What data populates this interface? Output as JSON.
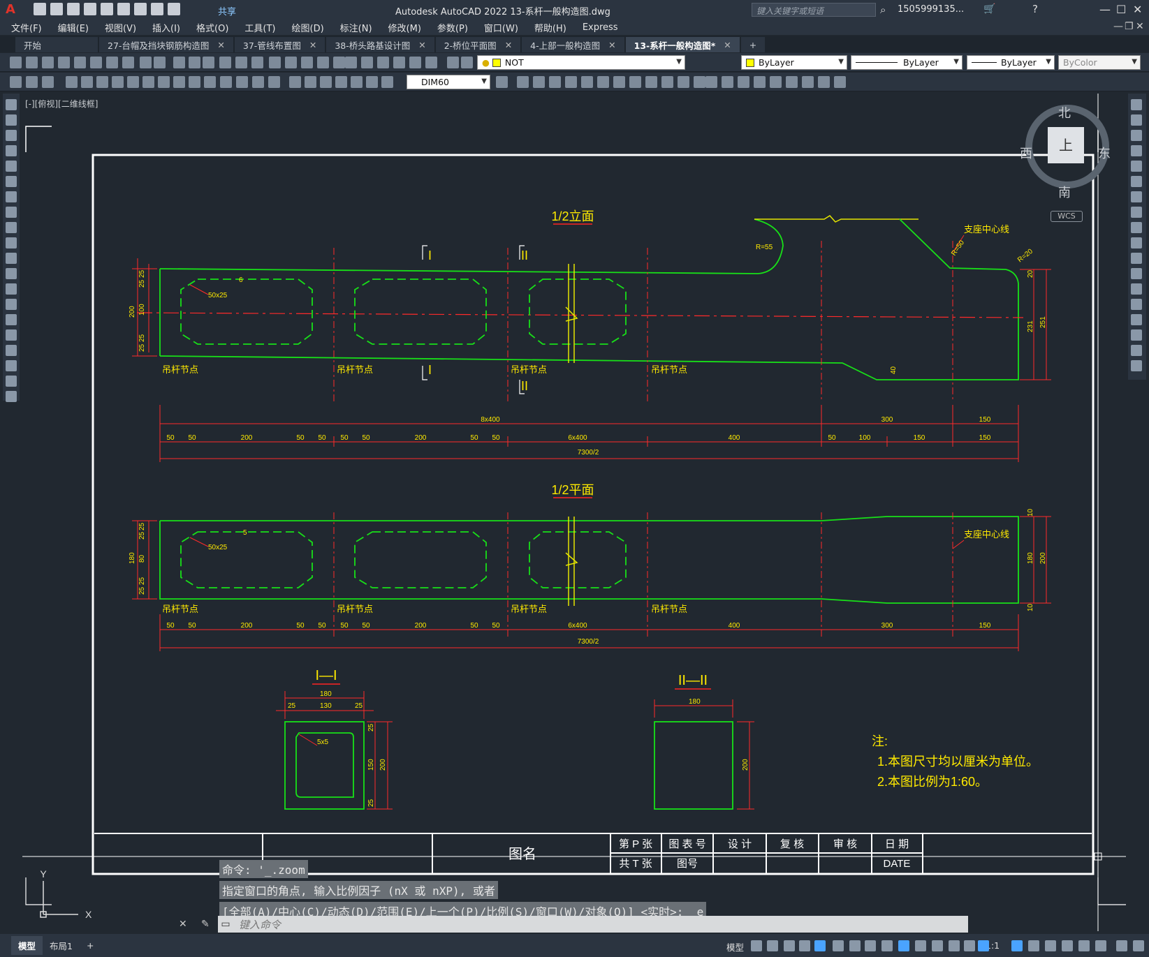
{
  "app": {
    "logo": "A",
    "title": "Autodesk AutoCAD 2022    13-系杆一般构造图.dwg",
    "share_label": "共享",
    "search_placeholder": "键入关键字或短语",
    "user": "1505999135...",
    "accent": "#e0332a"
  },
  "menus": [
    "文件(F)",
    "编辑(E)",
    "视图(V)",
    "插入(I)",
    "格式(O)",
    "工具(T)",
    "绘图(D)",
    "标注(N)",
    "修改(M)",
    "参数(P)",
    "窗口(W)",
    "帮助(H)",
    "Express"
  ],
  "file_tabs": [
    {
      "label": "开始",
      "closable": false,
      "active": false
    },
    {
      "label": "27-台帽及挡块钢筋构造图",
      "closable": true,
      "active": false
    },
    {
      "label": "37-管线布置图",
      "closable": true,
      "active": false
    },
    {
      "label": "38-桥头路基设计图",
      "closable": true,
      "active": false
    },
    {
      "label": "2-桥位平面图",
      "closable": true,
      "active": false
    },
    {
      "label": "4-上部一般构造图",
      "closable": true,
      "active": false
    },
    {
      "label": "13-系杆一般构造图*",
      "closable": true,
      "active": true
    }
  ],
  "toolbar": {
    "layer": "NOT",
    "color": "ByLayer",
    "linetype": "ByLayer",
    "lineweight": "ByLayer",
    "plotstyle": "ByColor",
    "dimstyle": "DIM60"
  },
  "viewport_label": "[-][俯视][二维线框]",
  "viewcube": {
    "north": "北",
    "south": "南",
    "east": "东",
    "west": "西",
    "face": "上",
    "wcs": "WCS"
  },
  "drawing": {
    "elev_title": "1/2立面",
    "plan_title": "1/2平面",
    "sec1_title": "I—I",
    "sec2_title": "II—II",
    "cut1": "I",
    "cut2": "II",
    "node_label": "吊杆节点",
    "support_label": "支座中心线",
    "hole": "50x25",
    "small_hole": "5x5",
    "r55": "R=55",
    "r50": "R=50",
    "r20": "R=20",
    "d6": "6",
    "d5": "5",
    "dims_row1": [
      "8x400",
      "300",
      "150"
    ],
    "dims_row2": [
      "50",
      "50",
      "200",
      "50",
      "50",
      "50",
      "50",
      "200",
      "50",
      "50",
      "6x400",
      "400",
      "50",
      "100",
      "150",
      "150"
    ],
    "dims_total": "7300/2",
    "plan_dims": [
      "50",
      "50",
      "200",
      "50",
      "50",
      "50",
      "50",
      "200",
      "50",
      "50",
      "6x400",
      "400",
      "300",
      "150"
    ],
    "elev_left": [
      "25",
      "25",
      "100",
      "25",
      "25",
      "200"
    ],
    "elev_right": [
      "20",
      "231",
      "251",
      "40"
    ],
    "plan_left": [
      "25",
      "25",
      "80",
      "25",
      "25",
      "180"
    ],
    "plan_right": [
      "10",
      "180",
      "200",
      "10"
    ],
    "sec1_dims": [
      "180",
      "25",
      "130",
      "25",
      "25",
      "150",
      "25",
      "200"
    ],
    "sec2_dims": [
      "180",
      "200"
    ],
    "note_title": "注:",
    "note1": "1.本图尺寸均以厘米为单位。",
    "note2": "2.本图比例为1:60。",
    "tb_name": "图名",
    "tb_cells": [
      "第 P 张",
      "图 表 号",
      "设  计",
      "复  核",
      "审  核",
      "日  期",
      "共 T 张",
      "图号",
      "DATE"
    ]
  },
  "command": {
    "history": [
      "命令: '_.zoom",
      "指定窗口的角点, 输入比例因子 (nX 或 nXP), 或者",
      "[全部(A)/中心(C)/动态(D)/范围(E)/上一个(P)/比例(S)/窗口(W)/对象(O)] <实时>: _e"
    ],
    "placeholder": "键入命令"
  },
  "status": {
    "layout_tabs": [
      "模型",
      "布局1"
    ],
    "model_label": "模型",
    "scale": "1:1"
  }
}
